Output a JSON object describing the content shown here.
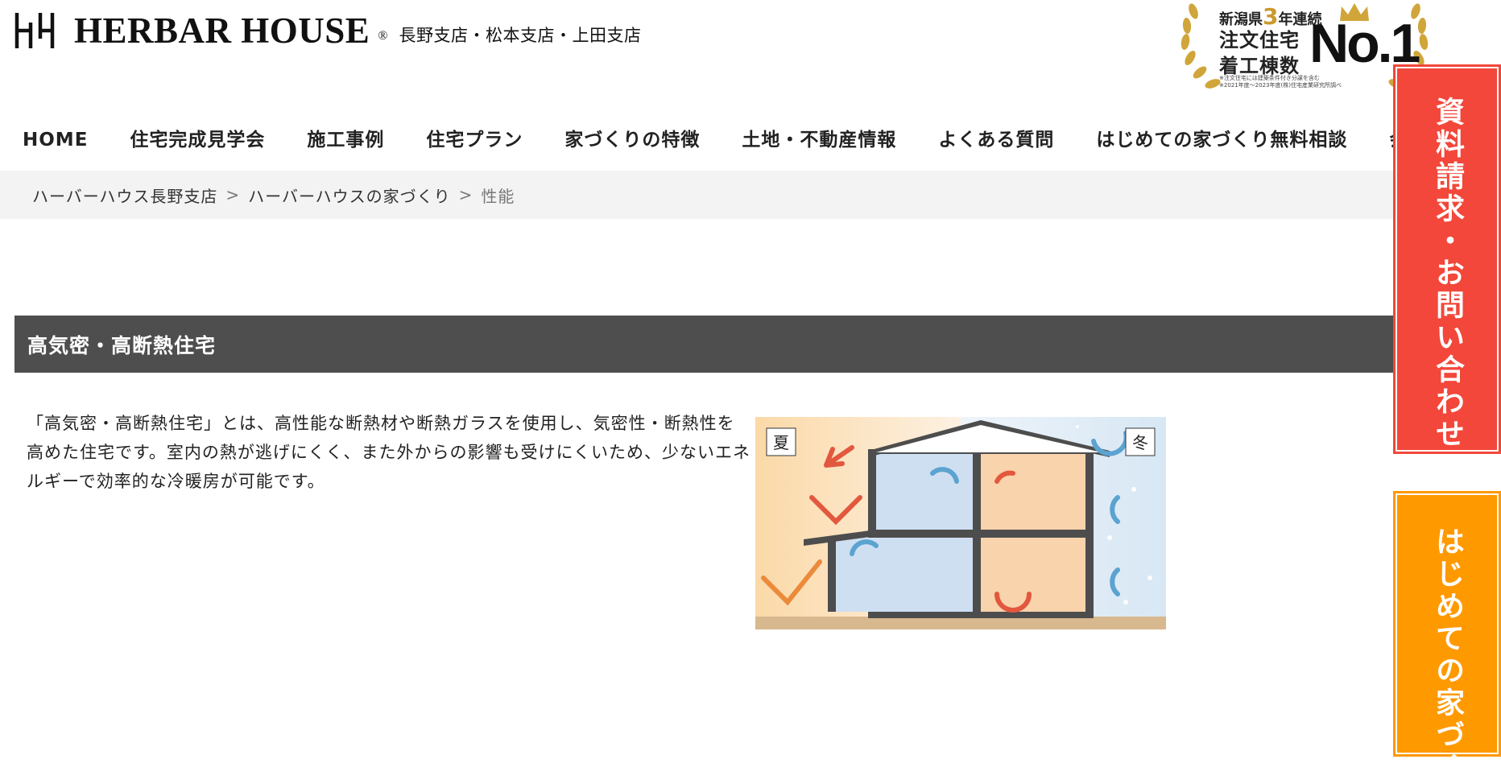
{
  "header": {
    "brand": "HERBAR HOUSE",
    "registered_mark": "®",
    "branches": "長野支店・松本支店・上田支店",
    "award": {
      "line1_prefix": "新潟県",
      "line1_number": "3",
      "line1_suffix": "年連続",
      "line2": "注文住宅",
      "line3": "着工棟数",
      "rank": "No.1",
      "note1": "※注文住宅には建築条件付き分譲を含む",
      "note2": "※2021年度〜2023年度(株)住宅産業研究所調べ",
      "gold_color": "#c99a2e"
    }
  },
  "nav": {
    "items": [
      "HOME",
      "住宅完成見学会",
      "施工事例",
      "住宅プラン",
      "家づくりの特徴",
      "土地・不動産情報",
      "よくある質問",
      "はじめての家づくり無料相談",
      "会"
    ]
  },
  "breadcrumb": {
    "items": [
      "ハーバーハウス長野支店",
      "ハーバーハウスの家づくり"
    ],
    "separator": ">",
    "current": "性能"
  },
  "section": {
    "title": "高気密・高断熱住宅",
    "body": "「高気密・高断熱住宅」とは、高性能な断熱材や断熱ガラスを使用し、気密性・断熱性を高めた住宅です。室内の熱が逃げにくく、また外からの影響も受けにくいため、少ないエネルギーで効率的な冷暖房が可能です。",
    "figure": {
      "summer_label": "夏",
      "winter_label": "冬"
    }
  },
  "side_tabs": {
    "request": "資料請求・お問い合わせ",
    "consult": "はじめての家づく",
    "request_color": "#f2473a",
    "consult_color": "#ff9900"
  }
}
